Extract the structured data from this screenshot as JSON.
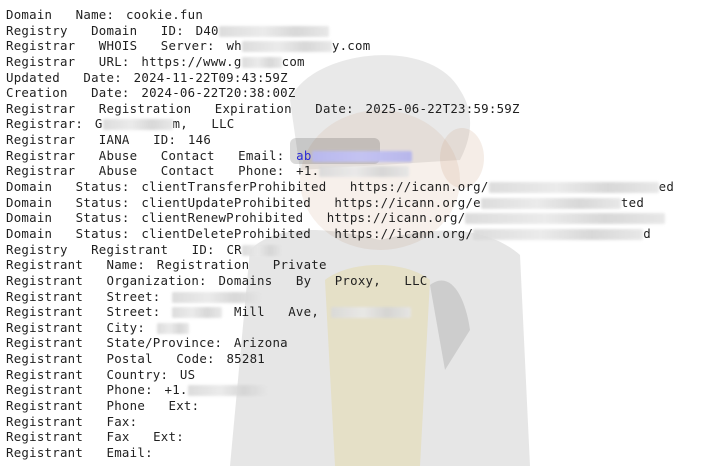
{
  "whois": {
    "lines": [
      {
        "key": "Domain  Name:",
        "value": "cookie.fun"
      },
      {
        "key": "Registry  Domain  ID:",
        "value": "D40"
      },
      {
        "key": "Registrar  WHOIS  Server:",
        "value": "wh"
      },
      {
        "key": "Registrar  URL:",
        "value": "https://www.g"
      },
      {
        "key": "Updated  Date:",
        "value": "2024-11-22T09:43:59Z"
      },
      {
        "key": "Creation  Date:",
        "value": "2024-06-22T20:38:00Z"
      },
      {
        "key": "Registrar  Registration  Expiration  Date:",
        "value": "2025-06-22T23:59:59Z"
      },
      {
        "key": "Registrar:",
        "value": "G"
      },
      {
        "key": "Registrar  IANA  ID:",
        "value": "146"
      },
      {
        "key": "Registrar  Abuse  Contact  Email:",
        "value": "ab"
      },
      {
        "key": "Registrar  Abuse  Contact  Phone:",
        "value": "+1."
      },
      {
        "key": "Domain  Status:",
        "value": "clientTransferProhibited  https://icann.org/"
      },
      {
        "key": "Domain  Status:",
        "value": "clientUpdateProhibited  https://icann.org/e"
      },
      {
        "key": "Domain  Status:",
        "value": "clientRenewProhibited  https://icann.org/"
      },
      {
        "key": "Domain  Status:",
        "value": "clientDeleteProhibited  https://icann.org/"
      },
      {
        "key": "Registry  Registrant  ID:",
        "value": "CR"
      },
      {
        "key": "Registrant  Name:",
        "value": "Registration  Private"
      },
      {
        "key": "Registrant  Organization:",
        "value": "Domains  By  Proxy,  LLC"
      },
      {
        "key": "Registrant  Street:",
        "value": ""
      },
      {
        "key": "Registrant  Street:",
        "value": "Mill  Ave,"
      },
      {
        "key": "Registrant  City:",
        "value": ""
      },
      {
        "key": "Registrant  State/Province:",
        "value": "Arizona"
      },
      {
        "key": "Registrant  Postal  Code:",
        "value": "85281"
      },
      {
        "key": "Registrant  Country:",
        "value": "US"
      },
      {
        "key": "Registrant  Phone:",
        "value": "+1."
      },
      {
        "key": "Registrant  Phone  Ext:",
        "value": ""
      },
      {
        "key": "Registrant  Fax:",
        "value": ""
      },
      {
        "key": "Registrant  Fax  Ext:",
        "value": ""
      },
      {
        "key": "Registrant  Email:",
        "value": ""
      }
    ]
  },
  "colors": {
    "text": "#1f1f1f",
    "background": "#ffffff",
    "redaction_email": "#b8b8f0",
    "redaction_generic": "#d9d9d9"
  },
  "icons": {
    "watermark": "cartoon-mascot-icon"
  }
}
